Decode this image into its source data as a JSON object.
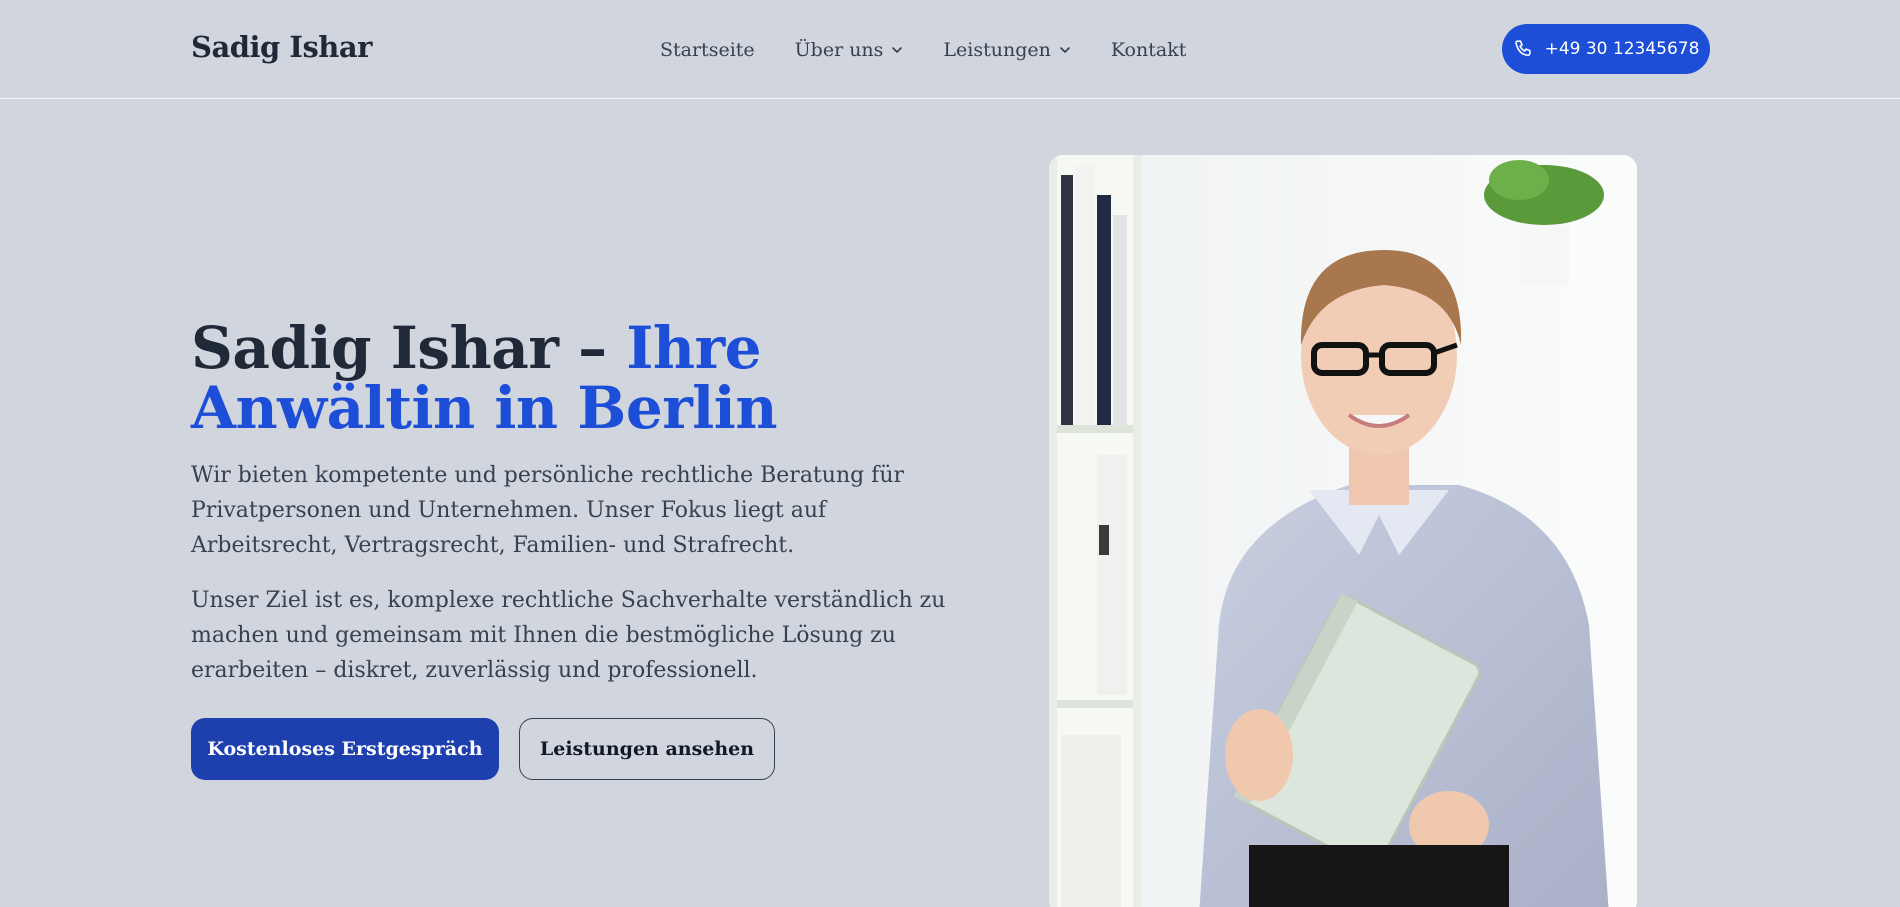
{
  "header": {
    "brand": "Sadig Ishar",
    "nav": [
      {
        "label": "Startseite",
        "has_dropdown": false
      },
      {
        "label": "Über uns",
        "has_dropdown": true
      },
      {
        "label": "Leistungen",
        "has_dropdown": true
      },
      {
        "label": "Kontakt",
        "has_dropdown": false
      }
    ],
    "phone": "+49 30 12345678"
  },
  "hero": {
    "title_main": "Sadig Ishar – ",
    "title_accent": "Ihre Anwältin in Berlin",
    "paragraph_1": "Wir bieten kompetente und persönliche rechtliche Beratung für Privatpersonen und Unternehmen. Unser Fokus liegt auf Arbeitsrecht, Vertragsrecht, Familien- und Strafrecht.",
    "paragraph_2": "Unser Ziel ist es, komplexe rechtliche Sachverhalte verständlich zu machen und gemeinsam mit Ihnen die bestmögliche Lösung zu erarbeiten – diskret, zuverlässig und professionell.",
    "primary_cta": "Kostenloses Erstgespräch",
    "secondary_cta": "Leistungen ansehen"
  },
  "colors": {
    "background": "#d1d5dd",
    "accent": "#1d4ed8",
    "primary_button": "#1e40af",
    "text": "#1f2937"
  },
  "icons": {
    "phone": "phone-icon",
    "dropdown": "chevron-down-icon"
  }
}
